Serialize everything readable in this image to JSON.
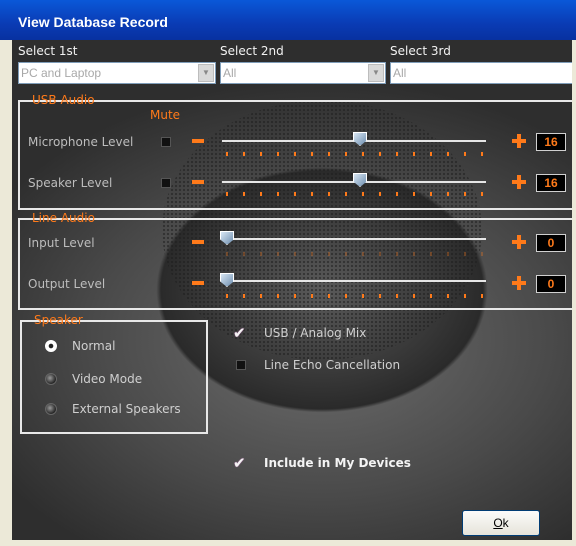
{
  "window": {
    "title": "View Database Record"
  },
  "selects": [
    {
      "label": "Select 1st",
      "value": "PC and Laptop"
    },
    {
      "label": "Select 2nd",
      "value": "All"
    },
    {
      "label": "Select 3rd",
      "value": "All"
    }
  ],
  "usb_audio": {
    "title": "USB Audio",
    "mute_header": "Mute",
    "rows": [
      {
        "label": "Microphone Level",
        "value": "16",
        "level": 0.5
      },
      {
        "label": "Speaker Level",
        "value": "16",
        "level": 0.5
      }
    ]
  },
  "line_audio": {
    "title": "Line Audio",
    "rows": [
      {
        "label": "Input Level",
        "value": "0",
        "level": 0.0
      },
      {
        "label": "Output Level",
        "value": "0",
        "level": 0.0
      }
    ]
  },
  "speaker": {
    "title": "Speaker",
    "options": [
      "Normal",
      "Video Mode",
      "External Speakers"
    ],
    "selected": "Normal"
  },
  "checks": {
    "usb_analog_mix": {
      "label": "USB / Analog Mix",
      "checked": true
    },
    "line_echo": {
      "label": "Line Echo Cancellation",
      "checked": false
    },
    "include_devices": {
      "label": "Include in My Devices",
      "checked": true
    }
  },
  "buttons": {
    "ok": "Ok"
  },
  "colors": {
    "accent": "#ff7a1a",
    "titlebar": "#0a48c8"
  }
}
